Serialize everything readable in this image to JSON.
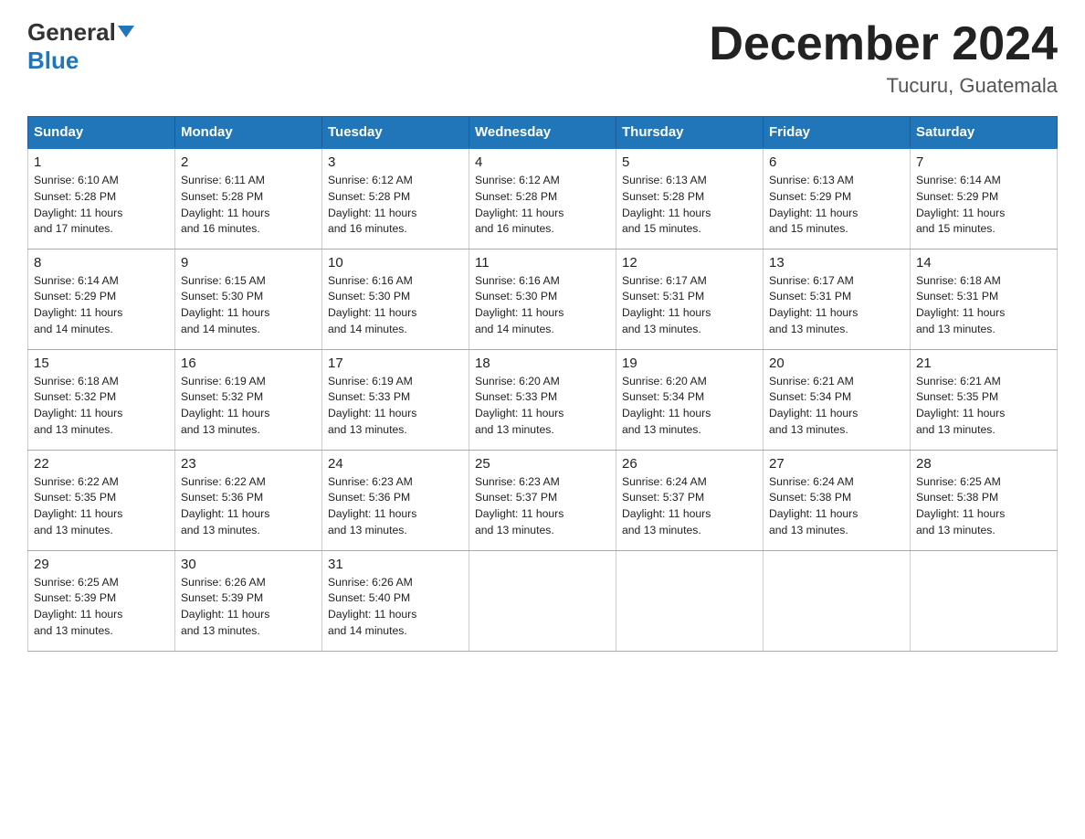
{
  "header": {
    "logo_general": "General",
    "logo_blue": "Blue",
    "month_title": "December 2024",
    "location": "Tucuru, Guatemala"
  },
  "days_of_week": [
    "Sunday",
    "Monday",
    "Tuesday",
    "Wednesday",
    "Thursday",
    "Friday",
    "Saturday"
  ],
  "weeks": [
    [
      {
        "day": "1",
        "sunrise": "6:10 AM",
        "sunset": "5:28 PM",
        "daylight": "11 hours and 17 minutes."
      },
      {
        "day": "2",
        "sunrise": "6:11 AM",
        "sunset": "5:28 PM",
        "daylight": "11 hours and 16 minutes."
      },
      {
        "day": "3",
        "sunrise": "6:12 AM",
        "sunset": "5:28 PM",
        "daylight": "11 hours and 16 minutes."
      },
      {
        "day": "4",
        "sunrise": "6:12 AM",
        "sunset": "5:28 PM",
        "daylight": "11 hours and 16 minutes."
      },
      {
        "day": "5",
        "sunrise": "6:13 AM",
        "sunset": "5:28 PM",
        "daylight": "11 hours and 15 minutes."
      },
      {
        "day": "6",
        "sunrise": "6:13 AM",
        "sunset": "5:29 PM",
        "daylight": "11 hours and 15 minutes."
      },
      {
        "day": "7",
        "sunrise": "6:14 AM",
        "sunset": "5:29 PM",
        "daylight": "11 hours and 15 minutes."
      }
    ],
    [
      {
        "day": "8",
        "sunrise": "6:14 AM",
        "sunset": "5:29 PM",
        "daylight": "11 hours and 14 minutes."
      },
      {
        "day": "9",
        "sunrise": "6:15 AM",
        "sunset": "5:30 PM",
        "daylight": "11 hours and 14 minutes."
      },
      {
        "day": "10",
        "sunrise": "6:16 AM",
        "sunset": "5:30 PM",
        "daylight": "11 hours and 14 minutes."
      },
      {
        "day": "11",
        "sunrise": "6:16 AM",
        "sunset": "5:30 PM",
        "daylight": "11 hours and 14 minutes."
      },
      {
        "day": "12",
        "sunrise": "6:17 AM",
        "sunset": "5:31 PM",
        "daylight": "11 hours and 13 minutes."
      },
      {
        "day": "13",
        "sunrise": "6:17 AM",
        "sunset": "5:31 PM",
        "daylight": "11 hours and 13 minutes."
      },
      {
        "day": "14",
        "sunrise": "6:18 AM",
        "sunset": "5:31 PM",
        "daylight": "11 hours and 13 minutes."
      }
    ],
    [
      {
        "day": "15",
        "sunrise": "6:18 AM",
        "sunset": "5:32 PM",
        "daylight": "11 hours and 13 minutes."
      },
      {
        "day": "16",
        "sunrise": "6:19 AM",
        "sunset": "5:32 PM",
        "daylight": "11 hours and 13 minutes."
      },
      {
        "day": "17",
        "sunrise": "6:19 AM",
        "sunset": "5:33 PM",
        "daylight": "11 hours and 13 minutes."
      },
      {
        "day": "18",
        "sunrise": "6:20 AM",
        "sunset": "5:33 PM",
        "daylight": "11 hours and 13 minutes."
      },
      {
        "day": "19",
        "sunrise": "6:20 AM",
        "sunset": "5:34 PM",
        "daylight": "11 hours and 13 minutes."
      },
      {
        "day": "20",
        "sunrise": "6:21 AM",
        "sunset": "5:34 PM",
        "daylight": "11 hours and 13 minutes."
      },
      {
        "day": "21",
        "sunrise": "6:21 AM",
        "sunset": "5:35 PM",
        "daylight": "11 hours and 13 minutes."
      }
    ],
    [
      {
        "day": "22",
        "sunrise": "6:22 AM",
        "sunset": "5:35 PM",
        "daylight": "11 hours and 13 minutes."
      },
      {
        "day": "23",
        "sunrise": "6:22 AM",
        "sunset": "5:36 PM",
        "daylight": "11 hours and 13 minutes."
      },
      {
        "day": "24",
        "sunrise": "6:23 AM",
        "sunset": "5:36 PM",
        "daylight": "11 hours and 13 minutes."
      },
      {
        "day": "25",
        "sunrise": "6:23 AM",
        "sunset": "5:37 PM",
        "daylight": "11 hours and 13 minutes."
      },
      {
        "day": "26",
        "sunrise": "6:24 AM",
        "sunset": "5:37 PM",
        "daylight": "11 hours and 13 minutes."
      },
      {
        "day": "27",
        "sunrise": "6:24 AM",
        "sunset": "5:38 PM",
        "daylight": "11 hours and 13 minutes."
      },
      {
        "day": "28",
        "sunrise": "6:25 AM",
        "sunset": "5:38 PM",
        "daylight": "11 hours and 13 minutes."
      }
    ],
    [
      {
        "day": "29",
        "sunrise": "6:25 AM",
        "sunset": "5:39 PM",
        "daylight": "11 hours and 13 minutes."
      },
      {
        "day": "30",
        "sunrise": "6:26 AM",
        "sunset": "5:39 PM",
        "daylight": "11 hours and 13 minutes."
      },
      {
        "day": "31",
        "sunrise": "6:26 AM",
        "sunset": "5:40 PM",
        "daylight": "11 hours and 14 minutes."
      },
      null,
      null,
      null,
      null
    ]
  ],
  "labels": {
    "sunrise": "Sunrise:",
    "sunset": "Sunset:",
    "daylight": "Daylight:"
  }
}
